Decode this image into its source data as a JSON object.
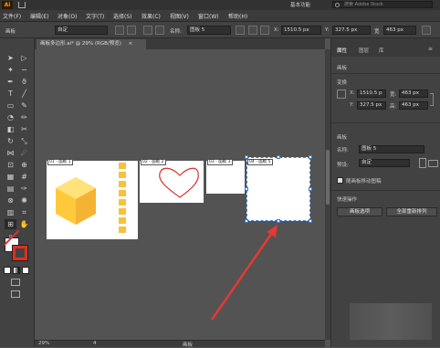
{
  "app": {
    "logo": "Ai",
    "workspace": "基本功能",
    "search_placeholder": "搜索 Adobe Stock"
  },
  "menu": [
    "文件(F)",
    "编辑(E)",
    "对象(O)",
    "文字(T)",
    "选择(S)",
    "效果(C)",
    "视图(V)",
    "窗口(W)",
    "帮助(H)"
  ],
  "controlbar": {
    "object_type": "画板",
    "preset": "自定",
    "name_label": "名称:",
    "name_value": "图板 5",
    "x_label": "X:",
    "x_value": "1510.5 px",
    "y_label": "Y:",
    "y_value": "327.5 px",
    "w_label": "宽",
    "w_value": "463 px"
  },
  "document": {
    "tab_title": "画板多边形.ai* @ 29% (RGB/预览)",
    "artboards": [
      {
        "label": "01 - 画板 1"
      },
      {
        "label": "02 - 画板 2"
      },
      {
        "label": "03 - 画板 3"
      },
      {
        "label": "04 - 画板 5"
      }
    ]
  },
  "statusbar": {
    "zoom": "29%",
    "artboard_index": "4",
    "tool_name": "画板"
  },
  "panel": {
    "tabs": [
      "属性",
      "图层",
      "库"
    ],
    "section_artboard": "画板",
    "section_transform": "变换",
    "x_label": "X:",
    "x_value": "1510.5 p",
    "w_label": "宽:",
    "w_value": "463 px",
    "y_label": "Y:",
    "y_value": "327.5 px",
    "h_label": "高:",
    "h_value": "463 px",
    "section_board": "画板",
    "name_label": "名称:",
    "name_value": "图板 5",
    "preset_label": "预设:",
    "preset_value": "自定",
    "move_with_art": "随画板移动图稿",
    "section_quick": "快速操作",
    "btn_board_options": "画板选项",
    "btn_rearrange": "全部重新排列"
  },
  "colors": {
    "accent": "#ff9a00",
    "selection": "#3a7bd5",
    "hexagon_light": "#ffd54f",
    "hexagon_dark": "#f5a623",
    "heart_stroke": "#d9302c",
    "arrow": "#e53935"
  }
}
